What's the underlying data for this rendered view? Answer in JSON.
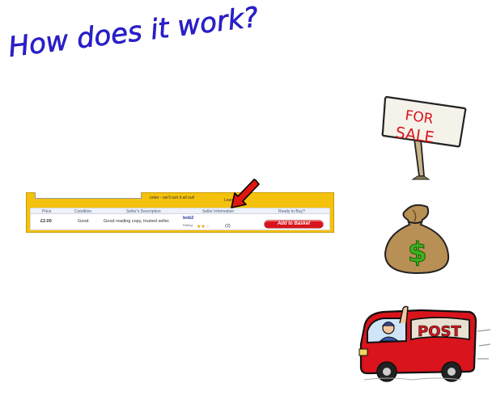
{
  "title": "How does it work?",
  "listing": {
    "tab_text": "order - we'll sort it all out!",
    "learn_more": "Learn m",
    "headers": [
      "Price",
      "Condition",
      "Seller's Description",
      "Seller Information",
      "Ready to Buy?"
    ],
    "row": {
      "price": "£2.00",
      "condition": "Good",
      "description": "Good reading copy, trusted seller.",
      "seller": "bob2",
      "rating_label": "Rating:",
      "rating_stars": 2,
      "rating_max": 5,
      "rating_count": "(2)",
      "button": "Add to Basket"
    }
  },
  "illustrations": {
    "sign_text_line1": "FOR",
    "sign_text_line2": "SALE",
    "bag_symbol": "$",
    "van_text": "POST"
  },
  "colors": {
    "title": "#2b1fd6",
    "listing_bg": "#f4c20d",
    "button": "#d9141c",
    "arrow": "#e0180f",
    "van": "#d9141c"
  }
}
